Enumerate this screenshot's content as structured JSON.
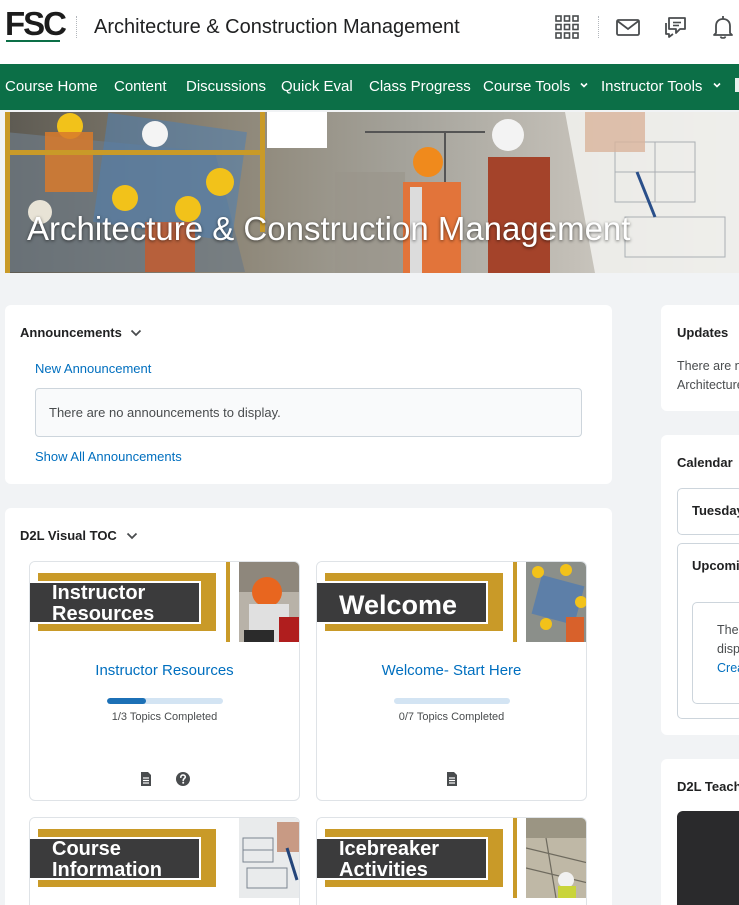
{
  "header": {
    "logo": "FSC",
    "course_title": "Architecture & Construction Management",
    "icons": [
      "apps-grid-icon",
      "mail-icon",
      "chat-icon",
      "bell-icon"
    ]
  },
  "nav": {
    "items": [
      {
        "label": "Course Home",
        "dropdown": false
      },
      {
        "label": "Content",
        "dropdown": false
      },
      {
        "label": "Discussions",
        "dropdown": false
      },
      {
        "label": "Quick Eval",
        "dropdown": false
      },
      {
        "label": "Class Progress",
        "dropdown": false
      },
      {
        "label": "Course Tools",
        "dropdown": true
      },
      {
        "label": "Instructor Tools",
        "dropdown": true
      }
    ]
  },
  "banner": {
    "title": "Architecture & Construction Management"
  },
  "announcements": {
    "title": "Announcements",
    "new_link": "New Announcement",
    "empty_text": "There are no announcements to display.",
    "show_all_link": "Show All Announcements"
  },
  "toc": {
    "title": "D2L Visual TOC",
    "cards": [
      {
        "banner_line1": "Instructor",
        "banner_line2": "Resources",
        "name": "Instructor Resources",
        "progress_text": "1/3  Topics Completed",
        "progress": 0.333,
        "icons": [
          "document-icon",
          "help-icon"
        ]
      },
      {
        "banner_line1": "Welcome",
        "banner_line2": "",
        "name": "Welcome- Start Here",
        "progress_text": "0/7  Topics Completed",
        "progress": 0,
        "icons": [
          "document-icon"
        ]
      },
      {
        "banner_line1": "Course",
        "banner_line2": "Information",
        "name": "",
        "progress_text": "",
        "progress": 0,
        "icons": []
      },
      {
        "banner_line1": "Icebreaker",
        "banner_line2": "Activities",
        "name": "",
        "progress_text": "",
        "progress": 0,
        "icons": []
      }
    ]
  },
  "updates": {
    "title": "Updates",
    "line1": "There are n",
    "line2": "Architecture"
  },
  "calendar": {
    "title": "Calendar",
    "day": "Tuesday",
    "upcoming": "Upcomin",
    "empty_line1": "The",
    "empty_line2": "disp",
    "create_link": "Crea"
  },
  "teacher": {
    "title": "D2L Teach"
  },
  "colors": {
    "brand_green": "#0c6f47",
    "link_blue": "#006fbf",
    "gold": "#c99a28"
  }
}
